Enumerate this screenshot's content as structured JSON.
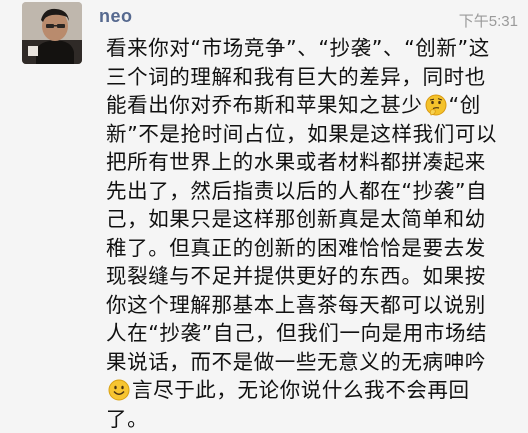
{
  "comment": {
    "author": "neo",
    "time": "下午5:31",
    "avatar_icon": "user-avatar-photo",
    "lines": [
      {
        "pre": "看来你对“市场竞争”、“抄袭”、“创新”这",
        "emoji": null,
        "post": ""
      },
      {
        "pre": "三个词的理解和我有巨大的差异，同时也",
        "emoji": null,
        "post": ""
      },
      {
        "pre": "能看出你对乔布斯和苹果知之甚少",
        "emoji": "thinking-face-emoji",
        "post": "“创"
      },
      {
        "pre": "新”不是抢时间占位，如果是这样我们可以",
        "emoji": null,
        "post": ""
      },
      {
        "pre": "把所有世界上的水果或者材料都拼凑起来",
        "emoji": null,
        "post": ""
      },
      {
        "pre": "先出了，然后指责以后的人都在“抄袭”自",
        "emoji": null,
        "post": ""
      },
      {
        "pre": "己，如果只是这样那创新真是太简单和幼",
        "emoji": null,
        "post": ""
      },
      {
        "pre": "稚了。但真正的创新的困难恰恰是要去发",
        "emoji": null,
        "post": ""
      },
      {
        "pre": "现裂缝与不足并提供更好的东西。如果按",
        "emoji": null,
        "post": ""
      },
      {
        "pre": "你这个理解那基本上喜茶每天都可以说别",
        "emoji": null,
        "post": ""
      },
      {
        "pre": "人在“抄袭”自己，但我们一向是用市场结",
        "emoji": null,
        "post": ""
      },
      {
        "pre": "果说话，而不是做一些无意义的无病呻吟",
        "emoji": null,
        "post": ""
      },
      {
        "pre": "",
        "emoji": "smiling-face-emoji",
        "post": "言尽于此，无论你说什么我不会再回"
      },
      {
        "pre": "了。",
        "emoji": null,
        "post": ""
      }
    ]
  },
  "colors": {
    "background": "#f5f5f5",
    "author": "#56698f",
    "timestamp": "#9a9a9a",
    "text": "#111111"
  }
}
